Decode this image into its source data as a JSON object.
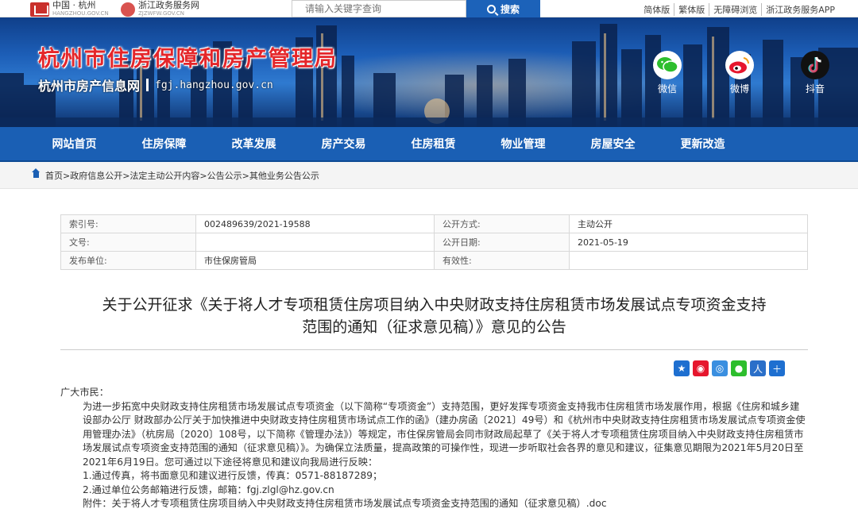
{
  "topbar": {
    "logo1_main": "中国 · 杭州",
    "logo1_sub": "HANGZHOU.GOV.CN",
    "logo2_main": "浙江政务服务网",
    "logo2_sub": "ZJZWFW.GOV.CN",
    "search_placeholder": "请输入关键字查询",
    "search_button": "搜索",
    "links": [
      "简体版",
      "繁体版",
      "无障碍浏览",
      "浙江政务服务APP"
    ]
  },
  "banner": {
    "title": "杭州市住房保障和房产管理局",
    "subtitle": "杭州市房产信息网",
    "url": "fgj.hangzhou.gov.cn",
    "social": [
      {
        "label": "微信",
        "icon": "wechat-icon"
      },
      {
        "label": "微博",
        "icon": "weibo-icon"
      },
      {
        "label": "抖音",
        "icon": "douyin-icon"
      }
    ]
  },
  "nav": [
    "网站首页",
    "住房保障",
    "改革发展",
    "房产交易",
    "住房租赁",
    "物业管理",
    "房屋安全",
    "更新改造"
  ],
  "breadcrumb": "首页>政府信息公开>法定主动公开内容>公告公示>其他业务公告公示",
  "meta": {
    "rows": [
      [
        "索引号:",
        "002489639/2021-19588",
        "公开方式:",
        "主动公开"
      ],
      [
        "文号:",
        "",
        "公开日期:",
        "2021-05-19"
      ],
      [
        "发布单位:",
        "市住保房管局",
        "有效性:",
        ""
      ]
    ]
  },
  "article": {
    "title_line1": "关于公开征求《关于将人才专项租赁住房项目纳入中央财政支持住房租赁市场发展试点专项资金支持",
    "title_line2": "范围的通知（征求意见稿）》意见的公告",
    "greeting": "广大市民：",
    "para1": "为进一步拓宽中央财政支持住房租赁市场发展试点专项资金（以下简称“专项资金”）支持范围，更好发挥专项资金支持我市住房租赁市场发展作用，根据《住房和城乡建设部办公厅 财政部办公厅关于加快推进中央财政支持住房租赁市场试点工作的函》（建办房函〔2021〕49号）和《杭州市中央财政支持住房租赁市场发展试点专项资金使用管理办法》（杭房局〔2020〕108号，以下简称《管理办法》）等规定，市住保房管局会同市财政局起草了《关于将人才专项租赁住房项目纳入中央财政支持住房租赁市场发展试点专项资金支持范围的通知（征求意见稿）》。为确保立法质量，提高政策的可操作性，现进一步听取社会各界的意见和建议，征集意见期限为2021年5月20日至2021年6月19日。您可通过以下途径将意见和建议向我局进行反映：",
    "item1": "1.通过传真，将书面意见和建议进行反馈，传真：0571-88187289；",
    "item2": "2.通过单位公务邮箱进行反馈，邮箱：fgj.zlgl@hz.gov.cn",
    "attachment": "附件：关于将人才专项租赁住房项目纳入中央财政支持住房租赁市场发展试点专项资金支持范围的通知（征求意见稿）.doc"
  }
}
